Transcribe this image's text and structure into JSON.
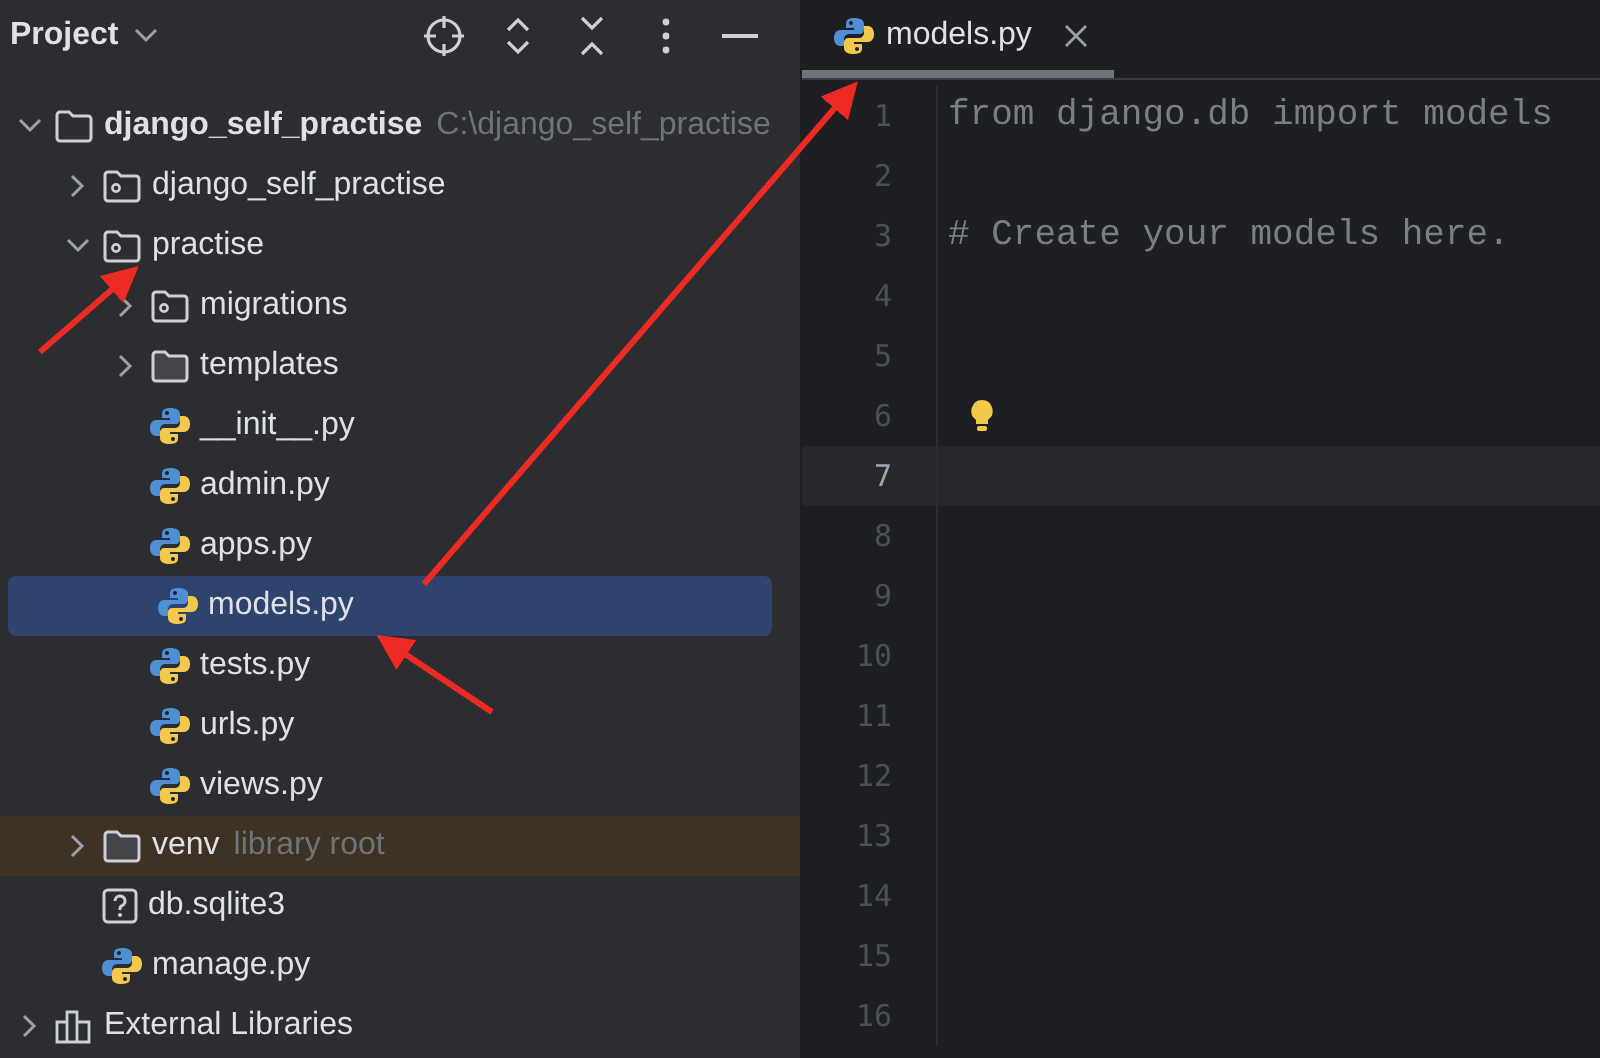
{
  "project_panel": {
    "title": "Project",
    "toolbar": [
      {
        "kind": "locate"
      },
      {
        "kind": "expand"
      },
      {
        "kind": "collapse"
      },
      {
        "kind": "more"
      },
      {
        "kind": "hide"
      }
    ],
    "tree": [
      {
        "label": "django_self_practise",
        "hint": "C:\\django_self_practise",
        "kind": "root",
        "expanded": true,
        "selected": false,
        "excluded": false,
        "children": [
          {
            "label": "django_self_practise",
            "kind": "package",
            "expanded": false,
            "selected": false,
            "excluded": false
          },
          {
            "label": "practise",
            "kind": "package",
            "expanded": true,
            "selected": false,
            "excluded": false,
            "children": [
              {
                "label": "migrations",
                "kind": "package",
                "expanded": false,
                "selected": false,
                "excluded": false
              },
              {
                "label": "templates",
                "kind": "folder",
                "expanded": false,
                "selected": false,
                "excluded": false
              },
              {
                "label": "__init__.py",
                "kind": "python",
                "selected": false,
                "excluded": false
              },
              {
                "label": "admin.py",
                "kind": "python",
                "selected": false,
                "excluded": false
              },
              {
                "label": "apps.py",
                "kind": "python",
                "selected": false,
                "excluded": false
              },
              {
                "label": "models.py",
                "kind": "python",
                "selected": true,
                "excluded": false
              },
              {
                "label": "tests.py",
                "kind": "python",
                "selected": false,
                "excluded": false
              },
              {
                "label": "urls.py",
                "kind": "python",
                "selected": false,
                "excluded": false
              },
              {
                "label": "views.py",
                "kind": "python",
                "selected": false,
                "excluded": false
              }
            ]
          },
          {
            "label": "venv",
            "hint": "library root",
            "kind": "folder",
            "expanded": false,
            "selected": false,
            "excluded": true
          },
          {
            "label": "db.sqlite3",
            "kind": "unknown",
            "selected": false,
            "excluded": false
          },
          {
            "label": "manage.py",
            "kind": "python",
            "selected": false,
            "excluded": false
          }
        ]
      },
      {
        "label": "External Libraries",
        "kind": "library",
        "expanded": false,
        "selected": false,
        "excluded": false
      }
    ]
  },
  "editor": {
    "tabs": [
      {
        "label": "models.py",
        "selected": true
      }
    ],
    "lines": [
      {
        "number": "1",
        "code": "from django.db import models",
        "current": false,
        "bulb": false
      },
      {
        "number": "2",
        "current": false,
        "bulb": false
      },
      {
        "number": "3",
        "code": "# Create your models here.",
        "current": false,
        "bulb": false
      },
      {
        "number": "4",
        "current": false,
        "bulb": false
      },
      {
        "number": "5",
        "current": false,
        "bulb": false
      },
      {
        "number": "6",
        "current": false,
        "bulb": true
      },
      {
        "number": "7",
        "current": true,
        "bulb": false
      },
      {
        "number": "8",
        "current": false,
        "bulb": false
      },
      {
        "number": "9",
        "current": false,
        "bulb": false
      },
      {
        "number": "10",
        "current": false,
        "bulb": false
      },
      {
        "number": "11",
        "current": false,
        "bulb": false
      },
      {
        "number": "12",
        "current": false,
        "bulb": false
      },
      {
        "number": "13",
        "current": false,
        "bulb": false
      },
      {
        "number": "14",
        "current": false,
        "bulb": false
      },
      {
        "number": "15",
        "current": false,
        "bulb": false
      },
      {
        "number": "16",
        "current": false,
        "bulb": false
      }
    ]
  }
}
